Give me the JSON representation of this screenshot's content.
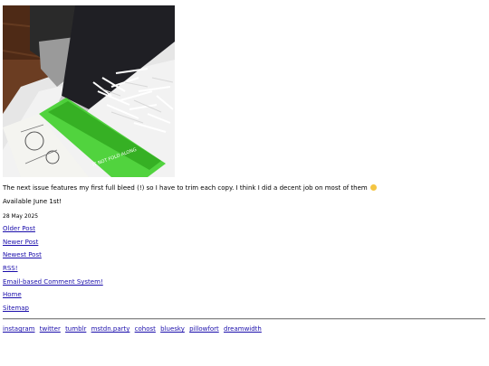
{
  "post": {
    "caption": "The next issue features my first full bleed (!) so I have to trim each copy. I think I did a decent job on most of them",
    "availability": "Available June 1st!",
    "date": "28 May 2025"
  },
  "nav": {
    "older": "Older Post",
    "newer": "Newer Post",
    "newest": "Newest Post",
    "rss": "RSS!",
    "comments": "Email-based Comment System!",
    "home": "Home",
    "sitemap": "Sitemap"
  },
  "social": [
    "instagram",
    "twitter",
    "tumblr",
    "mstdn.party",
    "cohost",
    "bluesky",
    "pillowfort",
    "dreamwidth"
  ],
  "photo_label": "IT NOT FOLD ALONG",
  "colors": {
    "link": "#1a0dab",
    "cutting_mat": "#3fcf2a",
    "table": "#6b3d22"
  }
}
